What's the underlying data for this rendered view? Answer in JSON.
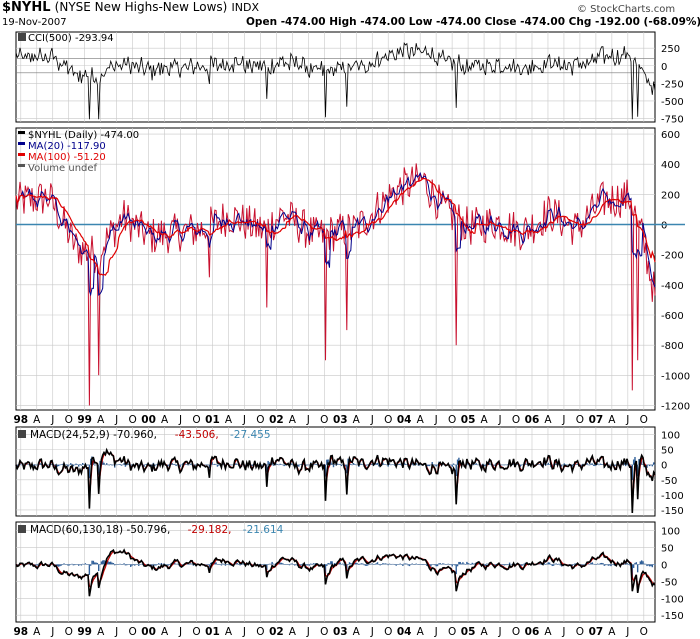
{
  "header": {
    "symbol": "$NYHL",
    "name": "(NYSE New Highs-New Lows)",
    "exchange": "INDX",
    "date": "19-Nov-2007",
    "quote": "Open -474.00  High -474.00  Low -474.00  Close -474.00  Chg -192.00 (-68.09%)",
    "credit": "© StockCharts.com"
  },
  "colors": {
    "price": "#c8102e",
    "ma_fast": "#00008b",
    "ma_slow": "#e00000",
    "histogram": "#2f5f99",
    "signal": "#c00000",
    "zero_line": "#3b86b0",
    "grid": "#c8c8c8",
    "cci_title": "#000000",
    "macd_signal_text": "#c00000",
    "macd_hist_text": "#3b86b0"
  },
  "x_axis": {
    "labels": [
      "98",
      "A",
      "J",
      "O",
      "99",
      "A",
      "J",
      "O",
      "00",
      "A",
      "J",
      "O",
      "01",
      "A",
      "J",
      "O",
      "02",
      "A",
      "J",
      "O",
      "03",
      "A",
      "J",
      "O",
      "04",
      "A",
      "J",
      "O",
      "05",
      "A",
      "J",
      "O",
      "06",
      "A",
      "J",
      "O",
      "07",
      "A",
      "J",
      "O"
    ]
  },
  "chart_data": [
    {
      "id": "cci",
      "type": "line",
      "title": "CCI(500) -293.94",
      "y_ticks": [
        250,
        0,
        -250,
        -500,
        -750
      ],
      "ylim": [
        -800,
        480
      ],
      "x": [
        "1998-01",
        "2007-11"
      ],
      "reference_lines": [
        100,
        -100
      ],
      "series": [
        {
          "name": "CCI(500)",
          "last": -293.94
        }
      ]
    },
    {
      "id": "price",
      "type": "line",
      "legend": [
        {
          "label": "$NYHL (Daily) -474.00",
          "color": "#000000"
        },
        {
          "label": "MA(20) -117.90",
          "color": "#00008b"
        },
        {
          "label": "MA(100) -51.20",
          "color": "#e00000"
        },
        {
          "label": "Volume undef",
          "color": "#555555"
        }
      ],
      "y_ticks": [
        600,
        400,
        200,
        0,
        -200,
        -400,
        -600,
        -800,
        -1000,
        -1200
      ],
      "ylim": [
        -1230,
        640
      ],
      "zero_line": 0,
      "series": [
        {
          "name": "$NYHL (Daily)",
          "last": -474.0
        },
        {
          "name": "MA(20)",
          "last": -117.9
        },
        {
          "name": "MA(100)",
          "last": -51.2
        }
      ]
    },
    {
      "id": "macd1",
      "type": "line",
      "legend": [
        {
          "label": "MACD(24,52,9) -70.960,",
          "color": "#000000"
        },
        {
          "label": "-43.506,",
          "color": "#c00000"
        },
        {
          "label": "-27.455",
          "color": "#3b86b0"
        }
      ],
      "y_ticks": [
        100,
        50,
        0,
        -50,
        -100,
        -150
      ],
      "ylim": [
        -170,
        125
      ],
      "series": [
        {
          "name": "MACD(24,52,9)",
          "last": -70.96
        },
        {
          "name": "Signal",
          "last": -43.506
        },
        {
          "name": "Histogram",
          "last": -27.455
        }
      ]
    },
    {
      "id": "macd2",
      "type": "line",
      "legend": [
        {
          "label": "MACD(60,130,18) -50.796,",
          "color": "#000000"
        },
        {
          "label": "-29.182,",
          "color": "#c00000"
        },
        {
          "label": "-21.614",
          "color": "#3b86b0"
        }
      ],
      "y_ticks": [
        100,
        50,
        0,
        -50,
        -100,
        -150
      ],
      "ylim": [
        -170,
        125
      ],
      "series": [
        {
          "name": "MACD(60,130,18)",
          "last": -50.796
        },
        {
          "name": "Signal",
          "last": -29.182
        },
        {
          "name": "Histogram",
          "last": -21.614
        }
      ]
    }
  ]
}
